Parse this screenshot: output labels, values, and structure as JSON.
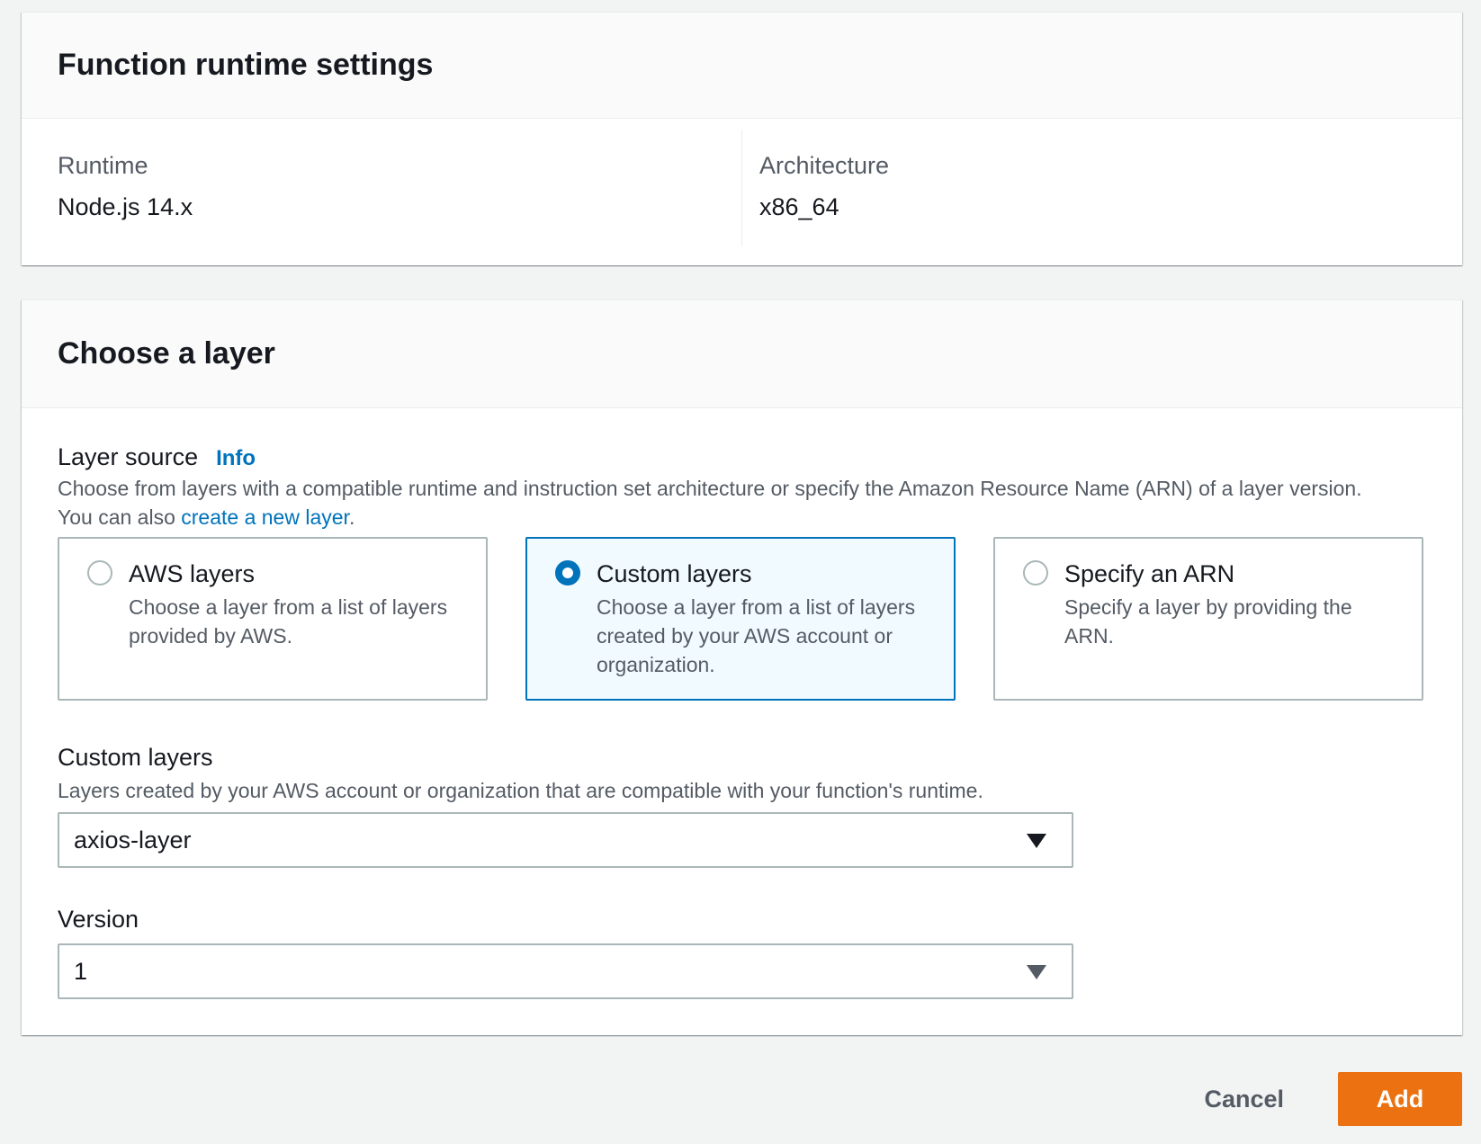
{
  "runtime_panel": {
    "title": "Function runtime settings",
    "runtime_label": "Runtime",
    "runtime_value": "Node.js 14.x",
    "architecture_label": "Architecture",
    "architecture_value": "x86_64"
  },
  "layer_panel": {
    "title": "Choose a layer",
    "layer_source": {
      "label": "Layer source",
      "info_link": "Info",
      "description_prefix": "Choose from layers with a compatible runtime and instruction set architecture or specify the Amazon Resource Name (ARN) of a layer version. You can also ",
      "description_link": "create a new layer",
      "description_suffix": "."
    },
    "options": [
      {
        "title": "AWS layers",
        "description": "Choose a layer from a list of layers provided by AWS.",
        "selected": false
      },
      {
        "title": "Custom layers",
        "description": "Choose a layer from a list of layers created by your AWS account or organization.",
        "selected": true
      },
      {
        "title": "Specify an ARN",
        "description": "Specify a layer by providing the ARN.",
        "selected": false
      }
    ],
    "custom_layers": {
      "label": "Custom layers",
      "description": "Layers created by your AWS account or organization that are compatible with your function's runtime.",
      "selected_value": "axios-layer"
    },
    "version": {
      "label": "Version",
      "selected_value": "1"
    }
  },
  "footer": {
    "cancel_label": "Cancel",
    "add_label": "Add"
  },
  "colors": {
    "accent_blue": "#0073bb",
    "primary_orange": "#ec7211",
    "background": "#f2f3f3"
  }
}
